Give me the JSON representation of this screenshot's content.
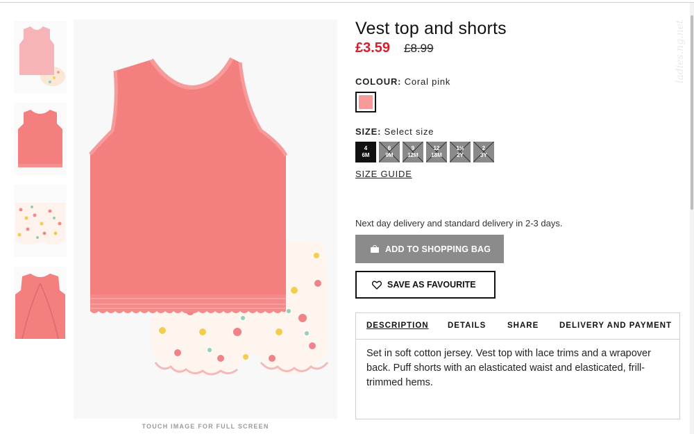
{
  "product": {
    "title": "Vest top and shorts",
    "price_now": "£3.59",
    "price_was": "£8.99"
  },
  "colour": {
    "label": "COLOUR:",
    "value": "Coral pink",
    "swatch_color": "#f69a9a"
  },
  "size": {
    "label": "SIZE:",
    "value": "Select size",
    "options": [
      {
        "top": "4",
        "bottom": "6M",
        "available": true,
        "selected": true
      },
      {
        "top": "6",
        "bottom": "9M",
        "available": false,
        "selected": false
      },
      {
        "top": "9",
        "bottom": "12M",
        "available": false,
        "selected": false
      },
      {
        "top": "12",
        "bottom": "18M",
        "available": false,
        "selected": false
      },
      {
        "top": "1½",
        "bottom": "2Y",
        "available": false,
        "selected": false
      },
      {
        "top": "2",
        "bottom": "3Y",
        "available": false,
        "selected": false
      }
    ],
    "guide_label": "SIZE GUIDE"
  },
  "delivery_text": "Next day delivery and standard delivery in 2-3 days.",
  "actions": {
    "add_to_bag": "ADD TO SHOPPING BAG",
    "save_favourite": "SAVE AS FAVOURITE"
  },
  "tabs": [
    {
      "label": "DESCRIPTION",
      "active": true
    },
    {
      "label": "DETAILS",
      "active": false
    },
    {
      "label": "SHARE",
      "active": false
    },
    {
      "label": "DELIVERY AND PAYMENT",
      "active": false
    }
  ],
  "description": "Set in soft cotton jersey. Vest top with lace trims and a wrapover back. Puff shorts with an elasticated waist and elasticated, frill-trimmed hems.",
  "gallery": {
    "hint": "TOUCH IMAGE FOR FULL SCREEN",
    "thumbnails": [
      {
        "name": "thumb-outfit"
      },
      {
        "name": "thumb-vest-front"
      },
      {
        "name": "thumb-shorts"
      },
      {
        "name": "thumb-vest-back"
      }
    ]
  },
  "colors": {
    "accent_red": "#d4202c",
    "coral": "#f47f7f",
    "button_grey": "#8b8b8b"
  },
  "watermark": "ladies.ng.net"
}
